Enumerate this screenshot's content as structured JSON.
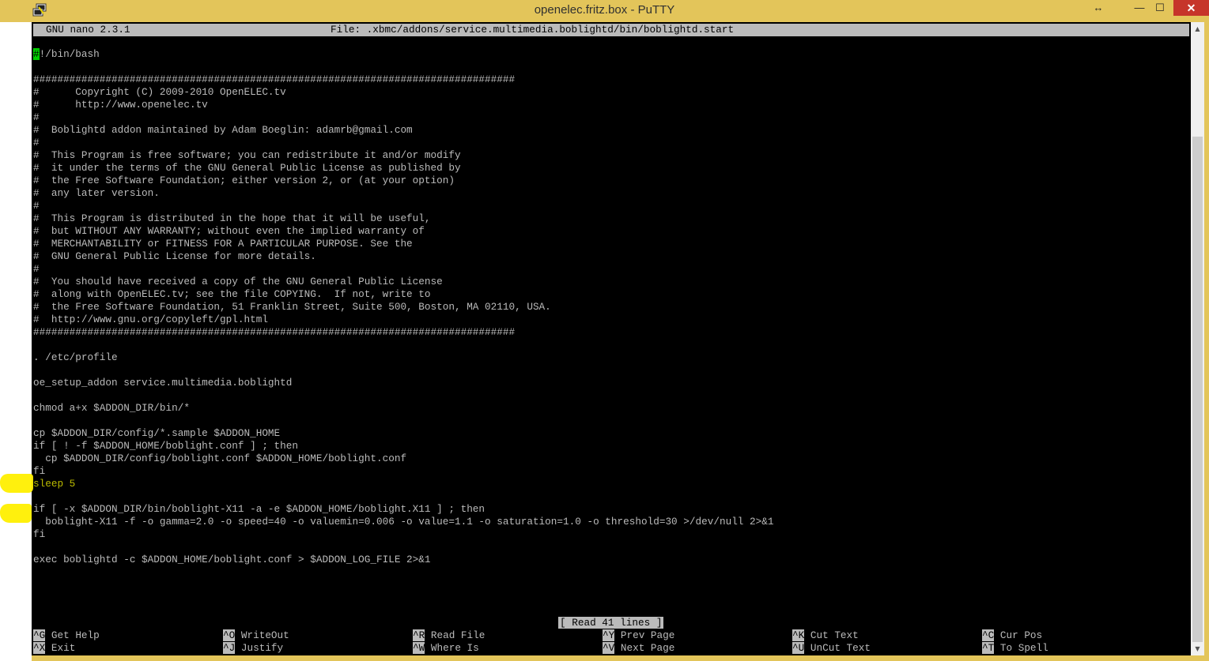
{
  "window": {
    "title": "openelec.fritz.box - PuTTY",
    "icon": "putty-icon",
    "controls": {
      "resize": "↔",
      "minimize": "—",
      "maximize": "☐",
      "close": "✕"
    }
  },
  "nano": {
    "version": "GNU nano 2.3.1",
    "file_label": "File: .xbmc/addons/service.multimedia.boblightd/bin/boblightd.start",
    "cursor_char": "#",
    "lines": [
      "!/bin/bash",
      "",
      "################################################################################",
      "#      Copyright (C) 2009-2010 OpenELEC.tv",
      "#      http://www.openelec.tv",
      "#",
      "#  Boblightd addon maintained by Adam Boeglin: adamrb@gmail.com",
      "#",
      "#  This Program is free software; you can redistribute it and/or modify",
      "#  it under the terms of the GNU General Public License as published by",
      "#  the Free Software Foundation; either version 2, or (at your option)",
      "#  any later version.",
      "#",
      "#  This Program is distributed in the hope that it will be useful,",
      "#  but WITHOUT ANY WARRANTY; without even the implied warranty of",
      "#  MERCHANTABILITY or FITNESS FOR A PARTICULAR PURPOSE. See the",
      "#  GNU General Public License for more details.",
      "#",
      "#  You should have received a copy of the GNU General Public License",
      "#  along with OpenELEC.tv; see the file COPYING.  If not, write to",
      "#  the Free Software Foundation, 51 Franklin Street, Suite 500, Boston, MA 02110, USA.",
      "#  http://www.gnu.org/copyleft/gpl.html",
      "################################################################################",
      "",
      ". /etc/profile",
      "",
      "oe_setup_addon service.multimedia.boblightd",
      "",
      "chmod a+x $ADDON_DIR/bin/*",
      "",
      "cp $ADDON_DIR/config/*.sample $ADDON_HOME",
      "if [ ! -f $ADDON_HOME/boblight.conf ] ; then",
      "  cp $ADDON_DIR/config/boblight.conf $ADDON_HOME/boblight.conf",
      "fi",
      "sleep 5",
      "",
      "if [ -x $ADDON_DIR/bin/boblight-X11 -a -e $ADDON_HOME/boblight.X11 ] ; then",
      "  boblight-X11 -f -o gamma=2.0 -o speed=40 -o valuemin=0.006 -o value=1.1 -o saturation=1.0 -o threshold=30 >/dev/null 2>&1",
      "fi",
      "",
      "exec boblightd -c $ADDON_HOME/boblight.conf > $ADDON_LOG_FILE 2>&1"
    ],
    "status": "[ Read 41 lines ]",
    "shortcuts": [
      {
        "key": "^G",
        "label": "Get Help"
      },
      {
        "key": "^O",
        "label": "WriteOut"
      },
      {
        "key": "^R",
        "label": "Read File"
      },
      {
        "key": "^Y",
        "label": "Prev Page"
      },
      {
        "key": "^K",
        "label": "Cut Text"
      },
      {
        "key": "^C",
        "label": "Cur Pos"
      },
      {
        "key": "^X",
        "label": "Exit"
      },
      {
        "key": "^J",
        "label": "Justify"
      },
      {
        "key": "^W",
        "label": "Where Is"
      },
      {
        "key": "^V",
        "label": "Next Page"
      },
      {
        "key": "^U",
        "label": "UnCut Text"
      },
      {
        "key": "^T",
        "label": "To Spell"
      }
    ]
  },
  "colors": {
    "titlebar": "#e3c55a",
    "terminal_bg": "#000000",
    "terminal_fg": "#bbbbbb",
    "highlight_text": "#bbbb00",
    "cursor": "#00cc00",
    "marker": "#ffef00",
    "close_button": "#c6352a"
  }
}
